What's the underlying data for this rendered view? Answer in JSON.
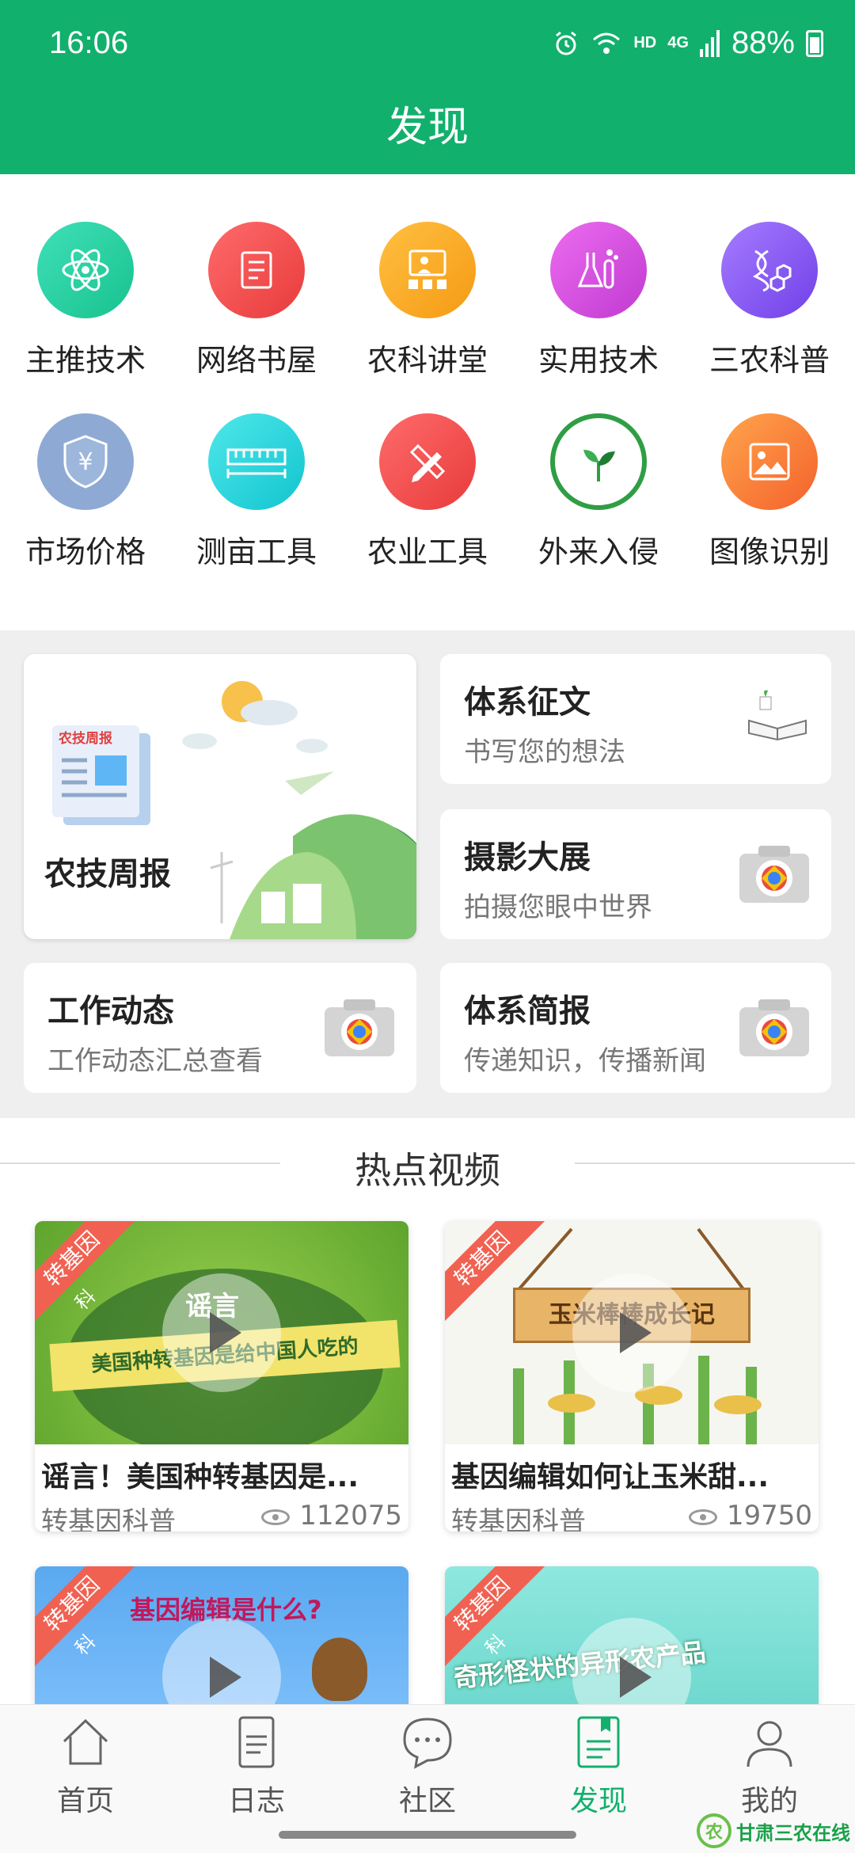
{
  "status": {
    "time": "16:06",
    "hd": "HD",
    "net": "4G",
    "battery": "88%"
  },
  "header": {
    "title": "发现"
  },
  "grid": [
    {
      "label": "主推技术",
      "icon": "atom-icon",
      "color": "#25d3a7"
    },
    {
      "label": "网络书屋",
      "icon": "book-icon",
      "color": "#f04a4a"
    },
    {
      "label": "农科讲堂",
      "icon": "lecture-icon",
      "color": "#f5a623"
    },
    {
      "label": "实用技术",
      "icon": "flask-icon",
      "color": "#d84fd8"
    },
    {
      "label": "三农科普",
      "icon": "dna-icon",
      "color": "#8a5cf0"
    },
    {
      "label": "市场价格",
      "icon": "yuan-shield-icon",
      "color": "#8eaad4"
    },
    {
      "label": "测亩工具",
      "icon": "ruler-icon",
      "color": "#22d3d3"
    },
    {
      "label": "农业工具",
      "icon": "pencil-ruler-icon",
      "color": "#f04a4a"
    },
    {
      "label": "外来入侵",
      "icon": "leaf-icon",
      "color": "#2f9e44"
    },
    {
      "label": "图像识别",
      "icon": "image-icon",
      "color": "#f4793b"
    }
  ],
  "cards": {
    "weekly": {
      "title": "农技周报",
      "badge": "农技周报"
    },
    "essay": {
      "title": "体系征文",
      "sub": "书写您的想法"
    },
    "photo": {
      "title": "摄影大展",
      "sub": "拍摄您眼中世界"
    },
    "work": {
      "title": "工作动态",
      "sub": "工作动态汇总查看"
    },
    "brief": {
      "title": "体系简报",
      "sub": "传递知识，传播新闻"
    }
  },
  "videos": {
    "section_title": "热点视频",
    "items": [
      {
        "title": "谣言！美国种转基因是...",
        "tag": "转基因科普",
        "views": "112075",
        "ribbon": "转基因",
        "ribbon_sub": "科",
        "thumb_text": "谣言",
        "thumb_text2": "美国种转基因是给中国人吃的",
        "bg": "#6fb63a"
      },
      {
        "title": "基因编辑如何让玉米甜...",
        "tag": "转基因科普",
        "views": "19750",
        "ribbon": "转基因",
        "ribbon_sub": "",
        "thumb_text": "玉米棒棒成长记",
        "thumb_text2": "",
        "bg": "#f4f4ee"
      },
      {
        "title": "",
        "tag": "",
        "views": "",
        "ribbon": "转基因",
        "ribbon_sub": "科",
        "thumb_text": "基因编辑是什么?",
        "thumb_text2": "",
        "bg": "#5aa9f0"
      },
      {
        "title": "",
        "tag": "",
        "views": "",
        "ribbon": "转基因",
        "ribbon_sub": "科",
        "thumb_text": "奇形怪状的异形农产品",
        "thumb_text2": "",
        "bg": "#6fd6cf"
      }
    ]
  },
  "tabs": [
    {
      "label": "首页",
      "icon": "home-icon"
    },
    {
      "label": "日志",
      "icon": "log-icon"
    },
    {
      "label": "社区",
      "icon": "chat-icon"
    },
    {
      "label": "发现",
      "icon": "discover-icon",
      "active": true
    },
    {
      "label": "我的",
      "icon": "user-icon"
    }
  ],
  "watermark": {
    "logo": "农",
    "text": "甘肃三农在线"
  }
}
